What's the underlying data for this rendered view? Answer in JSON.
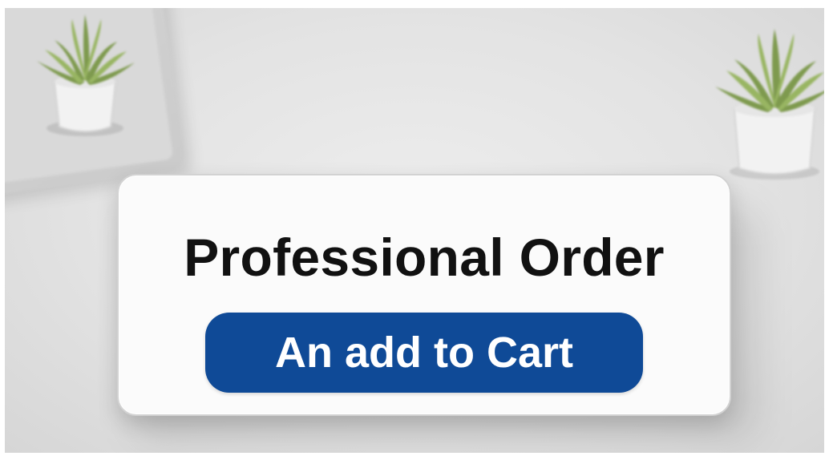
{
  "card": {
    "title": "Professional Order",
    "button_label": "An add to Cart"
  },
  "colors": {
    "button_background": "#0f4a97",
    "button_text": "#ffffff",
    "title_text": "#111111",
    "card_background": "#fbfbfb",
    "desk_background": "#e3e3e3"
  },
  "decor": {
    "left_icon": "potted-plant-icon",
    "right_icon": "potted-plant-icon",
    "device_icon": "tablet-device"
  }
}
